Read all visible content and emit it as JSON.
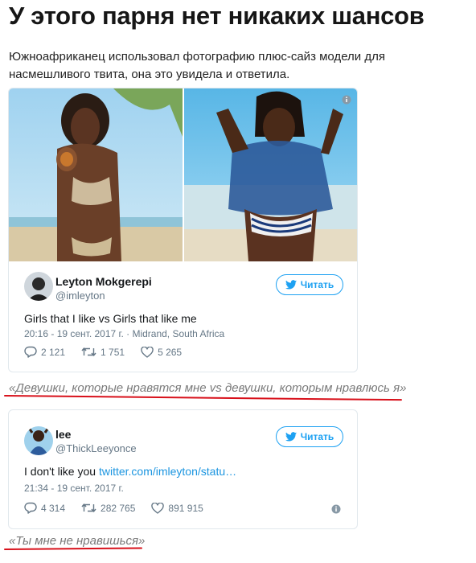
{
  "article": {
    "title": "У этого парня нет никаких шансов",
    "lead": "Южноафриканец использовал фотографию плюс-сайз модели для насмешливого твита, она это увидела и ответила."
  },
  "tweet1": {
    "name": "Leyton Mokgerepi",
    "handle": "@imleyton",
    "follow_label": "Читать",
    "text": "Girls that I like vs Girls that like me",
    "meta": "20:16 - 19 сент. 2017 г. · Midrand, South Africa",
    "replies": "2 121",
    "retweets": "1 751",
    "likes": "5 265"
  },
  "caption1": "«Девушки, которые нравятся мне vs девушки, которым нравлюсь я»",
  "tweet2": {
    "name": "lee",
    "handle": "@ThickLeeyonce",
    "follow_label": "Читать",
    "text_prefix": "I don't like you ",
    "link_text": "twitter.com/imleyton/statu…",
    "meta": "21:34 - 19 сент. 2017 г.",
    "replies": "4 314",
    "retweets": "282 765",
    "likes": "891 915"
  },
  "caption2": "«Ты мне не нравишься»",
  "colors": {
    "twitter_blue": "#1da1f2",
    "link_blue": "#1b95e0",
    "meta_gray": "#657786",
    "underline_red": "#d8101a"
  }
}
